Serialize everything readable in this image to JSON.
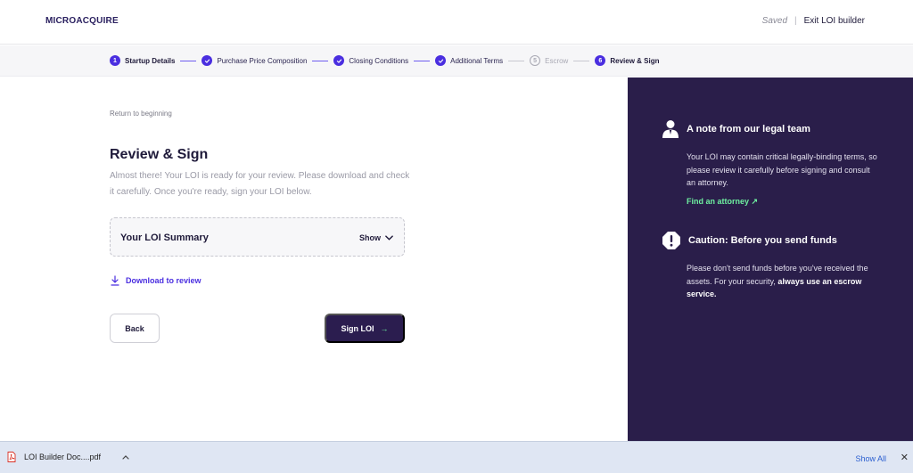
{
  "header": {
    "logo": "MICROACQUIRE",
    "saved": "Saved",
    "separator": "|",
    "exit_label": "Exit LOI builder"
  },
  "stepper": {
    "steps": [
      {
        "num": "1",
        "label": "Startup Details",
        "state": "active"
      },
      {
        "label": "Purchase Price Composition",
        "state": "done"
      },
      {
        "label": "Closing Conditions",
        "state": "done"
      },
      {
        "label": "Additional Terms",
        "state": "done"
      },
      {
        "num": "5",
        "label": "Escrow",
        "state": "pending"
      },
      {
        "num": "6",
        "label": "Review & Sign",
        "state": "active"
      }
    ]
  },
  "main": {
    "return_link": "Return to beginning",
    "title": "Review & Sign",
    "subtitle": "Almost there! Your LOI is ready for your review. Please download and check it carefully. Once you're ready, sign your LOI below.",
    "summary_title": "Your LOI Summary",
    "summary_toggle": "Show",
    "download_label": "Download to review",
    "back_label": "Back",
    "sign_label": "Sign LOI",
    "sign_arrow": "→"
  },
  "sidebar": {
    "note_title": "A note from our legal team",
    "note_body": "Your LOI may contain critical legally-binding terms, so please review it carefully before signing and consult an attorney.",
    "note_link": "Find an attorney ↗",
    "caution_title": "Caution: Before you send funds",
    "caution_body_prefix": "Please don't send funds before you've received the assets. For your security, ",
    "caution_body_bold": "always use an escrow service."
  },
  "download_bar": {
    "file_name": "LOI Builder Doc....pdf",
    "show_all": "Show All",
    "close": "✕"
  },
  "colors": {
    "accent": "#4a2ee0",
    "sidebar_bg": "#2a1e4a",
    "link_green": "#6ef0a0"
  }
}
